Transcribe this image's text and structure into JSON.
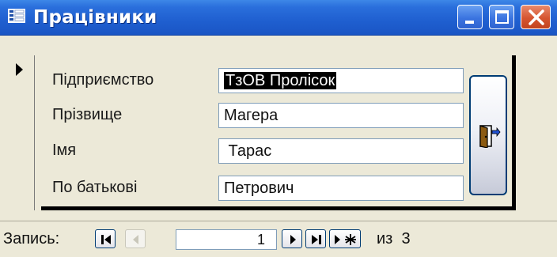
{
  "window": {
    "title": "Працівники",
    "title_bar_color": "#2a6fdc",
    "controls": [
      "minimize-icon",
      "maximize-icon",
      "close-icon"
    ]
  },
  "form": {
    "fields": [
      {
        "label": "Підприємство",
        "value": "ТзОВ Пролісок",
        "selected": true
      },
      {
        "label": "Прізвище",
        "value": "Магера"
      },
      {
        "label": "Імя",
        "value": " Тарас"
      },
      {
        "label": "По батькові",
        "value": "Петрович"
      }
    ],
    "exit_button_icon": "exit-door-icon"
  },
  "navigation": {
    "label": "Запись:",
    "current_record": "1",
    "total_text": "из  3",
    "buttons": [
      "first-record-icon",
      "previous-record-icon",
      "next-record-icon",
      "last-record-icon",
      "new-record-icon"
    ]
  }
}
